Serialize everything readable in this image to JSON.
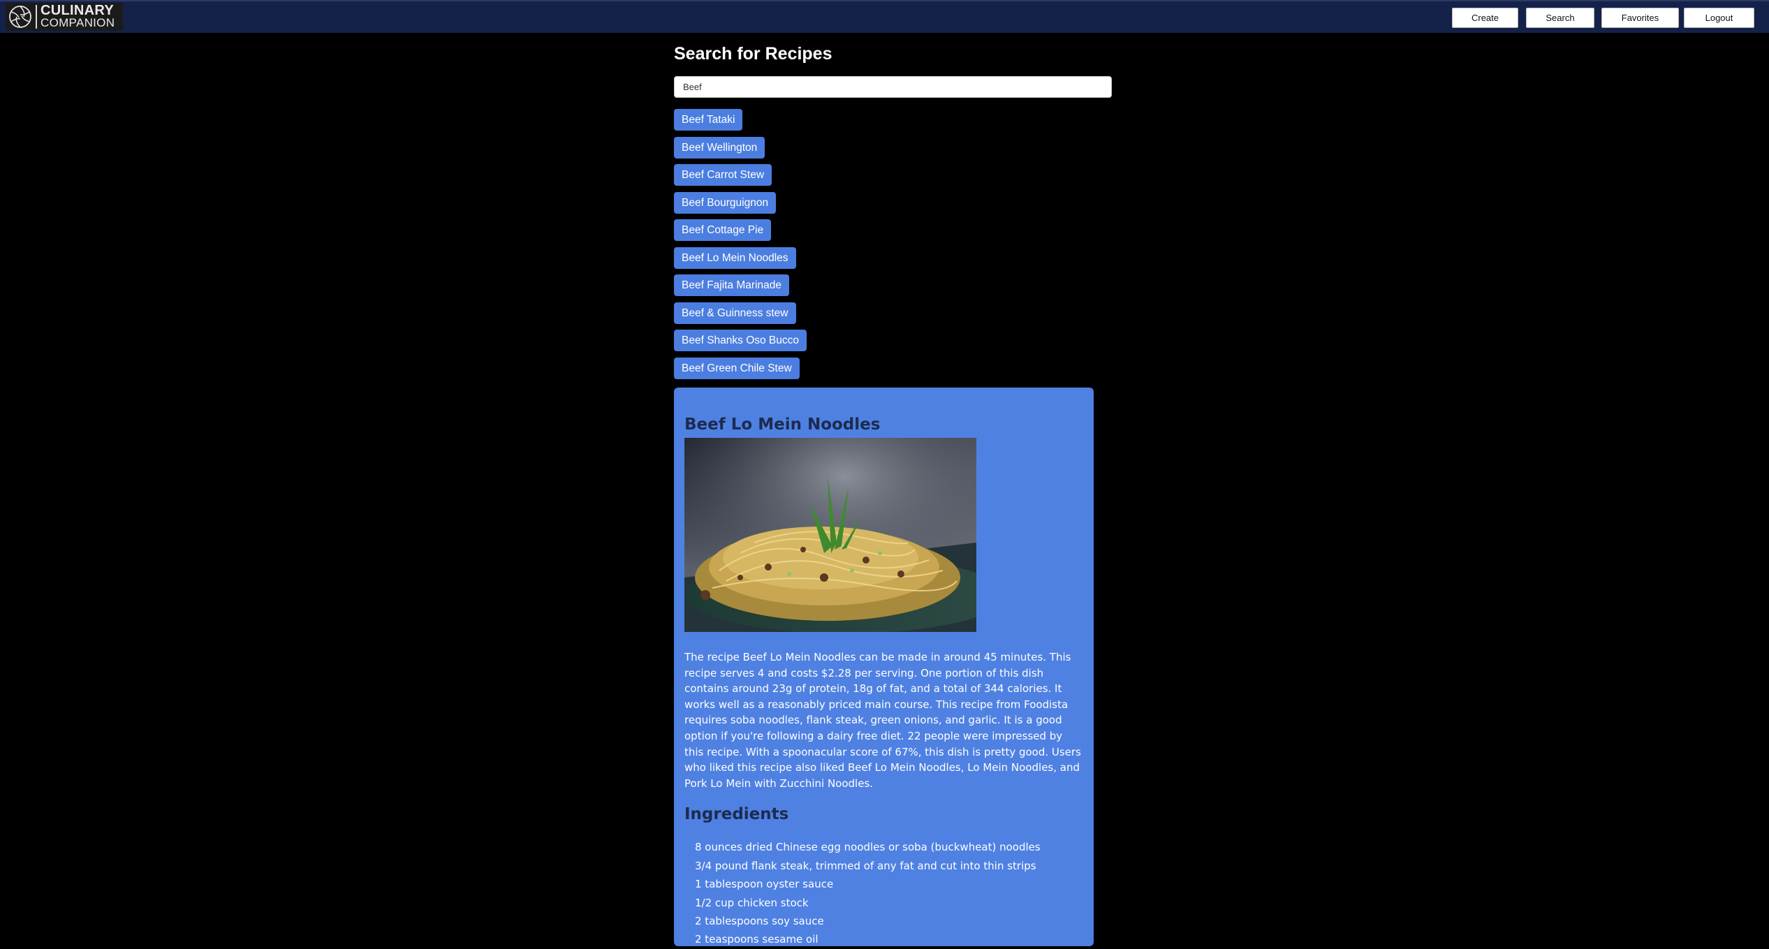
{
  "header": {
    "logo": {
      "line1": "CULINARY",
      "line2": "COMPANION",
      "icon": "aperture-logo-icon"
    },
    "nav": [
      {
        "label": "Create"
      },
      {
        "label": "Search"
      },
      {
        "label": "Favorites"
      },
      {
        "label": "Logout"
      }
    ]
  },
  "search": {
    "title": "Search for Recipes",
    "value": "Beef",
    "results": [
      {
        "label": "Beef Tataki"
      },
      {
        "label": "Beef Wellington"
      },
      {
        "label": "Beef Carrot Stew"
      },
      {
        "label": "Beef Bourguignon"
      },
      {
        "label": "Beef Cottage Pie"
      },
      {
        "label": "Beef Lo Mein Noodles"
      },
      {
        "label": "Beef Fajita Marinade"
      },
      {
        "label": "Beef & Guinness stew"
      },
      {
        "label": "Beef Shanks Oso Bucco"
      },
      {
        "label": "Beef Green Chile Stew"
      }
    ]
  },
  "recipe": {
    "title": "Beef Lo Mein Noodles",
    "image": "noodle-dish-photo",
    "description": "The recipe Beef Lo Mein Noodles can be made in around 45 minutes. This recipe serves 4 and costs $2.28 per serving. One portion of this dish contains around 23g of protein, 18g of fat, and a total of 344 calories. It works well as a reasonably priced main course. This recipe from Foodista requires soba noodles, flank steak, green onions, and garlic. It is a good option if you're following a dairy free diet. 22 people were impressed by this recipe. With a spoonacular score of 67%, this dish is pretty good. Users who liked this recipe also liked Beef Lo Mein Noodles, Lo Mein Noodles, and Pork Lo Mein with Zucchini Noodles.",
    "ingredients_title": "Ingredients",
    "ingredients": [
      "8 ounces dried Chinese egg noodles or soba (buckwheat) noodles",
      "3/4 pound flank steak, trimmed of any fat and cut into thin strips",
      "1 tablespoon oyster sauce",
      "1/2 cup chicken stock",
      "2 tablespoons soy sauce",
      "2 teaspoons sesame oil"
    ]
  },
  "colors": {
    "navbar": "#14224a",
    "result_button": "#4b7ee0",
    "card": "#4f81e3",
    "heading": "#1d2b4f"
  }
}
